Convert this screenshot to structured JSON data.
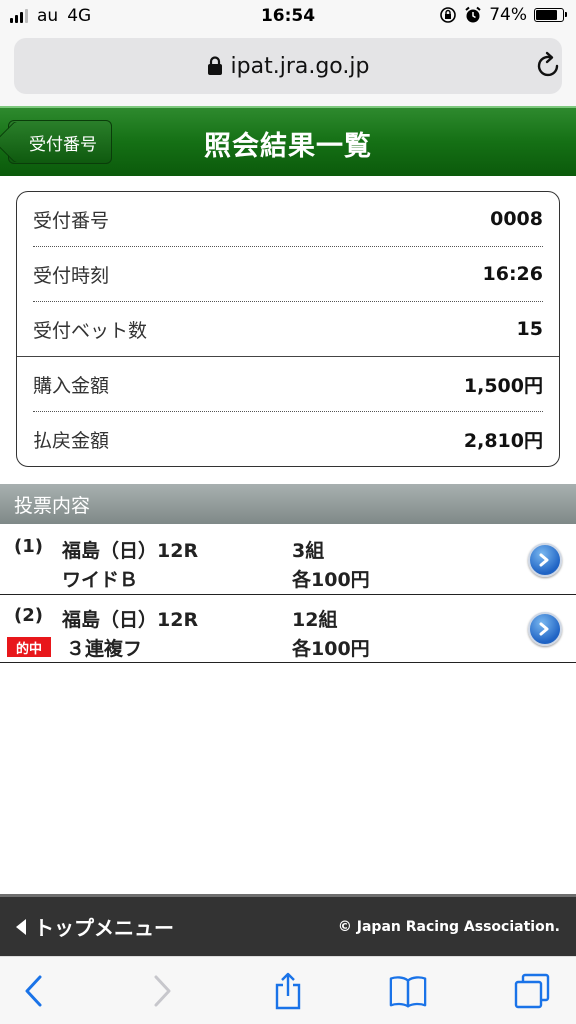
{
  "status_bar": {
    "carrier": "au",
    "network": "4G",
    "time": "16:54",
    "battery_percent": "74%",
    "battery_level": 0.74
  },
  "browser": {
    "url": "ipat.jra.go.jp"
  },
  "header": {
    "back_label": "受付番号",
    "title": "照会結果一覧",
    "color": "#157015"
  },
  "receipt": {
    "rows": [
      {
        "label": "受付番号",
        "value": "0008"
      },
      {
        "label": "受付時刻",
        "value": "16:26"
      },
      {
        "label": "受付ベット数",
        "value": "15"
      },
      {
        "label": "購入金額",
        "value": "1,500円"
      },
      {
        "label": "払戻金額",
        "value": "2,810円"
      }
    ]
  },
  "bets": {
    "section_title": "投票内容",
    "items": [
      {
        "num": "(1)",
        "race": "福島（日）12R",
        "type": "ワイドＢ",
        "sets": "3組",
        "amount": "各100円",
        "hit": ""
      },
      {
        "num": "(2)",
        "race": "福島（日）12R",
        "type": "３連複フ",
        "sets": "12組",
        "amount": "各100円",
        "hit": "的中"
      }
    ]
  },
  "footer": {
    "menu_label": "トップメニュー",
    "copyright": "© Japan Racing Association."
  },
  "toolbar": {
    "icons": [
      "back-icon",
      "forward-icon",
      "share-icon",
      "bookmarks-icon",
      "tabs-icon"
    ]
  }
}
